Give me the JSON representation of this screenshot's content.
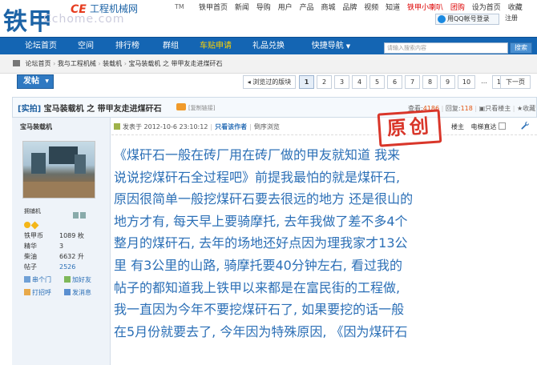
{
  "header": {
    "logo_cn": "铁甲",
    "logo_en": "CE",
    "logo_sub": "工程机械网",
    "logo_watermark": "Cchome.com",
    "logo_tm": "TM",
    "top_links": [
      "铁甲首页",
      "新闻",
      "导购",
      "用户",
      "产品",
      "商城",
      "品牌",
      "视频",
      "知道"
    ],
    "top_links_red": [
      "铁甲小喇叭",
      "团购",
      "设为首页",
      "收藏"
    ],
    "qq_login": "用QQ帐号登录",
    "quick_links": "注册"
  },
  "nav": {
    "items": [
      {
        "label": "论坛首页"
      },
      {
        "label": "空间"
      },
      {
        "label": "排行榜"
      },
      {
        "label": "群组"
      },
      {
        "label": "车贴申请",
        "active": true
      },
      {
        "label": "礼品兑换"
      },
      {
        "label": "快捷导航"
      }
    ],
    "search_placeholder": "请输入搜索内容",
    "search_button": "搜索"
  },
  "breadcrumb": [
    "论坛首页",
    "我与工程机械",
    "装载机",
    "宝马装载机 之 带甲友走进煤矸石"
  ],
  "toolbar": {
    "post_button": "发帖",
    "back_label": "浏览过的版块",
    "pages": [
      "1",
      "2",
      "3",
      "4",
      "5",
      "6",
      "7",
      "8",
      "9",
      "10",
      "...",
      "12"
    ],
    "current_page": "1",
    "next_label": "下一页"
  },
  "thread": {
    "tag": "[实拍]",
    "title": "宝马装载机 之 带甲友走进煤矸石",
    "copy_label": "[复制链接]",
    "views_label": "查看:",
    "views": "4186",
    "replies_label": "回复:",
    "replies": "118",
    "print_label": "只看楼主",
    "fav_label": "收藏"
  },
  "author": {
    "name": "宝马装载机",
    "rank": "拥铺机",
    "stats": [
      {
        "label": "铁甲币",
        "value": "1089 枚"
      },
      {
        "label": "精华",
        "value": "3"
      },
      {
        "label": "柴油",
        "value": "6632 升"
      },
      {
        "label": "帖子",
        "value": "2526",
        "link": true
      }
    ],
    "actions": [
      "串个门",
      "加好友",
      "打招呼",
      "发消息"
    ]
  },
  "post": {
    "posted_label": "发表于 2012-10-6 23:10:12",
    "only_author": "只看该作者",
    "reverse": "倒序浏览",
    "floor": "楼主",
    "reading_mode": "电梯直达",
    "stamp": "原创",
    "lines": [
      "《煤矸石一般在砖厂用在砖厂做的甲友就知道  我来",
      "说说挖煤矸石全过程吧》前提我最怕的就是煤矸石,",
      "原因很简单一般挖煤矸石要去很远的地方 还是很山的",
      "地方才有, 每天早上要骑摩托, 去年我做了差不多4个",
      "整月的煤矸石, 去年的场地还好点因为理我家才13公",
      "里  有3公里的山路, 骑摩托要40分钟左右, 看过我的",
      "帖子的都知道我上铁甲以来都是在富民街的工程做,",
      "我一直因为今年不要挖煤矸石了, 如果要挖的话一般",
      "在5月份就要去了, 今年因为特殊原因, 《因为煤矸石"
    ]
  },
  "colors": {
    "nav_bg": "#1465b3",
    "accent": "#e25411",
    "body_text": "#2b6fb6",
    "stamp": "#d9362a"
  }
}
